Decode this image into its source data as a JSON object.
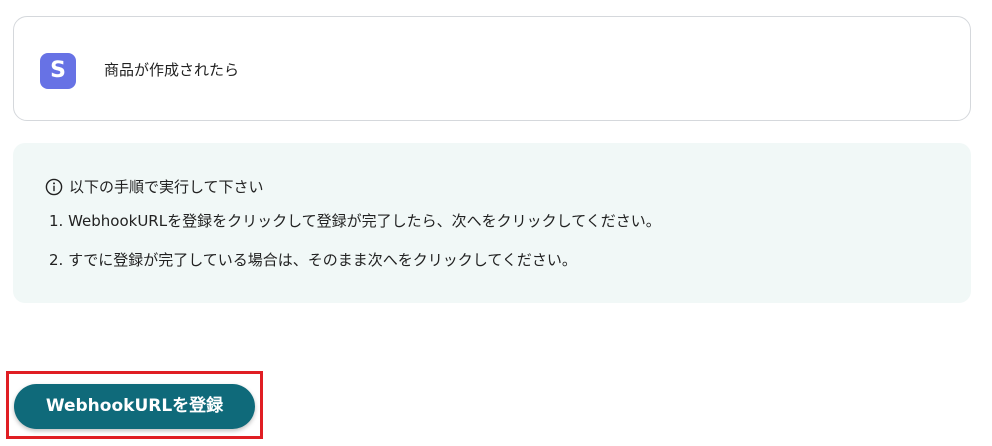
{
  "trigger": {
    "icon_letter": "S",
    "icon": "stripe-icon",
    "label": "商品が作成されたら"
  },
  "instructions": {
    "icon": "info-icon",
    "heading": "以下の手順で実行して下さい",
    "steps": [
      "1. WebhookURLを登録をクリックして登録が完了したら、次へをクリックしてください。",
      "2. すでに登録が完了している場合は、そのまま次へをクリックしてください。"
    ]
  },
  "register_button": {
    "label": "WebhookURLを登録"
  },
  "colors": {
    "accent": "#0f6a7a",
    "stripe": "#6772e5",
    "info_bg": "#f1f8f7",
    "highlight": "#e01e23"
  }
}
